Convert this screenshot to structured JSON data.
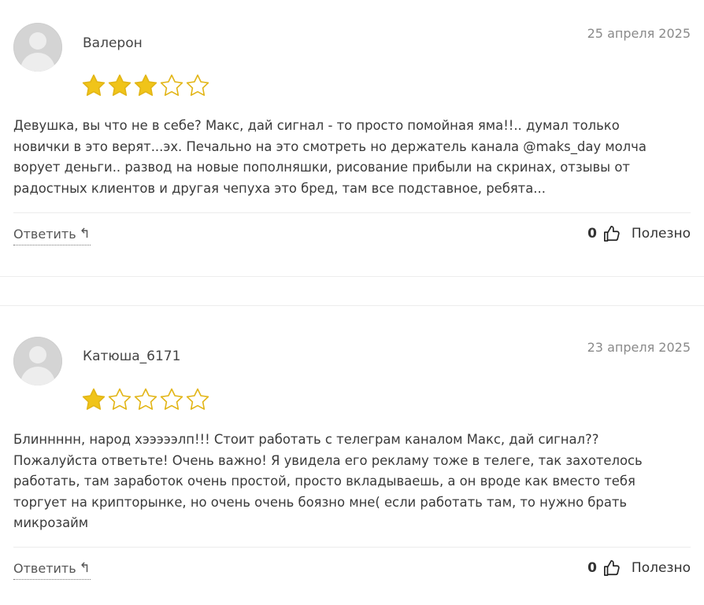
{
  "reviews": [
    {
      "author": "Валерон",
      "date": "25 апреля 2025",
      "rating": 3,
      "max_rating": 5,
      "lines": [
        "Девушка, вы что не в себе? Макс, дай сигнал - то просто помойная яма!!.. думал только",
        "новички в это верят...эх. Печально на это смотреть но держатель канала @maks_day молча",
        "ворует деньги.. развод на новые пополняшки, рисование прибыли на скринах, отзывы от",
        "радостных клиентов и другая чепуха это бред, там все подставное, ребята..."
      ],
      "reply_label": "Ответить",
      "likes": "0",
      "useful_label": "Полезно"
    },
    {
      "author": "Катюша_6171",
      "date": "23 апреля 2025",
      "rating": 1,
      "max_rating": 5,
      "lines": [
        "Блиннннн, народ хэээээлп!!! Стоит работать с телеграм каналом Макс, дай сигнал??",
        "Пожалуйста ответьте! Очень важно! Я увидела его рекламу тоже в телеге, так захотелось",
        "работать, там заработок очень простой, просто вкладываешь, а он вроде как вместо тебя",
        "торгует на крипторынке, но очень очень боязно мне( если работать там, то нужно брать",
        "микрозайм"
      ],
      "reply_label": "Ответить",
      "likes": "0",
      "useful_label": "Полезно"
    }
  ],
  "icons": {
    "reply": "reply-arrow-icon",
    "like": "thumbs-up-icon",
    "star": "star-icon"
  },
  "colors": {
    "star_filled": "#f0c419",
    "star_outline": "#e2b516"
  }
}
